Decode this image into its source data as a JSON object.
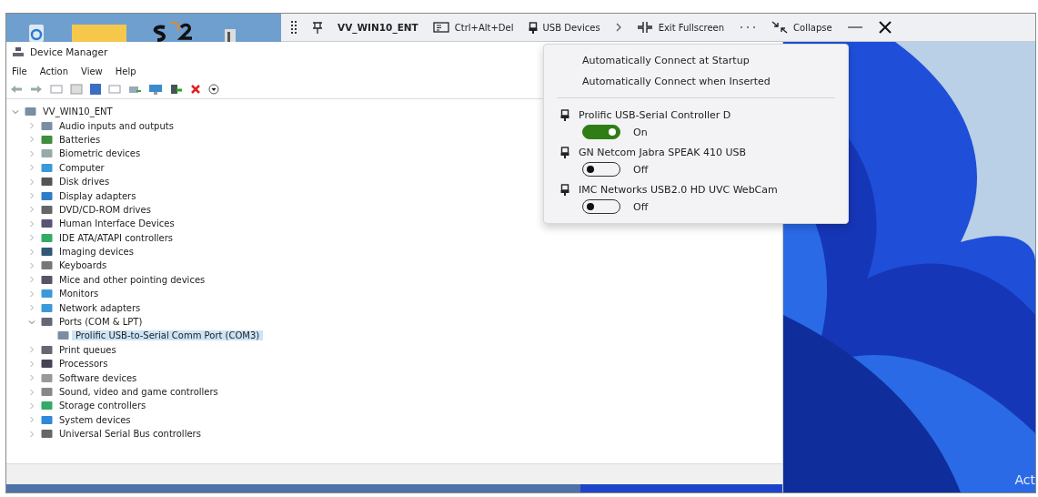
{
  "remote_toolbar": {
    "machine_name": "VV_WIN10_ENT",
    "items": [
      {
        "kind": "keys",
        "label": "Ctrl+Alt+Del"
      },
      {
        "kind": "usb",
        "label": "USB Devices"
      },
      {
        "kind": "chevron"
      },
      {
        "kind": "exit",
        "label": "Exit Fullscreen"
      },
      {
        "kind": "more"
      },
      {
        "kind": "collapse",
        "label": "Collapse"
      },
      {
        "kind": "minimize"
      },
      {
        "kind": "close"
      }
    ]
  },
  "window": {
    "title": "Device Manager"
  },
  "menu": [
    "File",
    "Action",
    "View",
    "Help"
  ],
  "tree": {
    "label": "VV_WIN10_ENT",
    "expanded": true,
    "children": [
      {
        "label": "Audio inputs and outputs",
        "expanded": false
      },
      {
        "label": "Batteries",
        "expanded": false
      },
      {
        "label": "Biometric devices",
        "expanded": false
      },
      {
        "label": "Computer",
        "expanded": false
      },
      {
        "label": "Disk drives",
        "expanded": false
      },
      {
        "label": "Display adapters",
        "expanded": false
      },
      {
        "label": "DVD/CD-ROM drives",
        "expanded": false
      },
      {
        "label": "Human Interface Devices",
        "expanded": false
      },
      {
        "label": "IDE ATA/ATAPI controllers",
        "expanded": false
      },
      {
        "label": "Imaging devices",
        "expanded": false
      },
      {
        "label": "Keyboards",
        "expanded": false
      },
      {
        "label": "Mice and other pointing devices",
        "expanded": false
      },
      {
        "label": "Monitors",
        "expanded": false
      },
      {
        "label": "Network adapters",
        "expanded": false
      },
      {
        "label": "Ports (COM & LPT)",
        "expanded": true,
        "children": [
          {
            "label": "Prolific USB-to-Serial Comm Port (COM3)",
            "selected": true
          }
        ]
      },
      {
        "label": "Print queues",
        "expanded": false
      },
      {
        "label": "Processors",
        "expanded": false
      },
      {
        "label": "Software devices",
        "expanded": false
      },
      {
        "label": "Sound, video and game controllers",
        "expanded": false
      },
      {
        "label": "Storage controllers",
        "expanded": false
      },
      {
        "label": "System devices",
        "expanded": false
      },
      {
        "label": "Universal Serial Bus controllers",
        "expanded": false
      }
    ]
  },
  "usb_menu": {
    "options": [
      "Automatically Connect at Startup",
      "Automatically Connect when Inserted"
    ],
    "devices": [
      {
        "name": "Prolific USB-Serial Controller D",
        "on": true,
        "state": "On"
      },
      {
        "name": "GN Netcom Jabra SPEAK 410 USB",
        "on": false,
        "state": "Off"
      },
      {
        "name": "IMC Networks USB2.0 HD UVC WebCam",
        "on": false,
        "state": "Off"
      }
    ]
  },
  "desktop_watermark": "Act"
}
